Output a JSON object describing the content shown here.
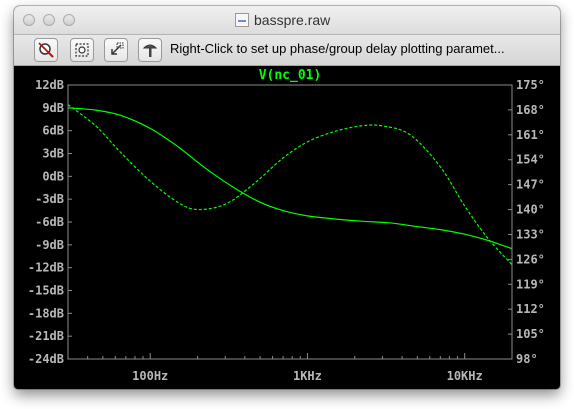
{
  "window": {
    "title": "basspre.raw"
  },
  "toolbar": {
    "buttons": [
      {
        "name": "zoom-cancel-button",
        "icon": "zoom-cancel-icon"
      },
      {
        "name": "autorange-button",
        "icon": "autorange-icon"
      },
      {
        "name": "pan-button",
        "icon": "pan-icon"
      },
      {
        "name": "probe-button",
        "icon": "probe-icon"
      }
    ],
    "status_text": "Right-Click to set up phase/group delay plotting paramet..."
  },
  "colors": {
    "trace": "#00ff00",
    "plot_background": "#000000",
    "axis_text": "#b8b8b8",
    "plot_border": "#8c8c8c"
  },
  "chart_data": {
    "type": "line",
    "title": "V(nc_01)",
    "x_scale": "log",
    "xlim": [
      30,
      20000
    ],
    "x_tick_labels": [
      {
        "x": 100,
        "label": "100Hz"
      },
      {
        "x": 1000,
        "label": "1KHz"
      },
      {
        "x": 10000,
        "label": "10KHz"
      }
    ],
    "y_left": {
      "unit": "dB",
      "ylim": [
        -24,
        12
      ],
      "tick_labels": [
        "12dB",
        "9dB",
        "6dB",
        "3dB",
        "0dB",
        "-3dB",
        "-6dB",
        "-9dB",
        "-12dB",
        "-15dB",
        "-18dB",
        "-21dB",
        "-24dB"
      ]
    },
    "y_right": {
      "unit": "°",
      "ylim": [
        98,
        175
      ],
      "tick_labels": [
        "175°",
        "168°",
        "161°",
        "154°",
        "147°",
        "140°",
        "133°",
        "126°",
        "119°",
        "112°",
        "105°",
        "98°"
      ]
    },
    "series": [
      {
        "style": "solid",
        "axis": "left",
        "x": [
          30,
          45,
          65,
          100,
          150,
          220,
          330,
          500,
          700,
          1000,
          1500,
          2200,
          3300,
          5000,
          7000,
          10000,
          14000,
          20000
        ],
        "values": [
          9.0,
          8.7,
          8.0,
          6.3,
          3.9,
          1.2,
          -1.3,
          -3.4,
          -4.5,
          -5.2,
          -5.6,
          -5.9,
          -6.1,
          -6.6,
          -7.0,
          -7.6,
          -8.4,
          -9.5
        ]
      },
      {
        "style": "dashed",
        "axis": "right",
        "x": [
          30,
          45,
          65,
          100,
          150,
          200,
          300,
          450,
          700,
          1000,
          1500,
          2200,
          3000,
          4500,
          7000,
          10000,
          14000,
          20000
        ],
        "values": [
          169.5,
          163.5,
          156,
          148,
          142,
          140,
          141.5,
          147,
          154.5,
          159,
          162,
          163.5,
          163.5,
          161,
          152,
          141,
          132,
          124.5
        ]
      }
    ]
  }
}
